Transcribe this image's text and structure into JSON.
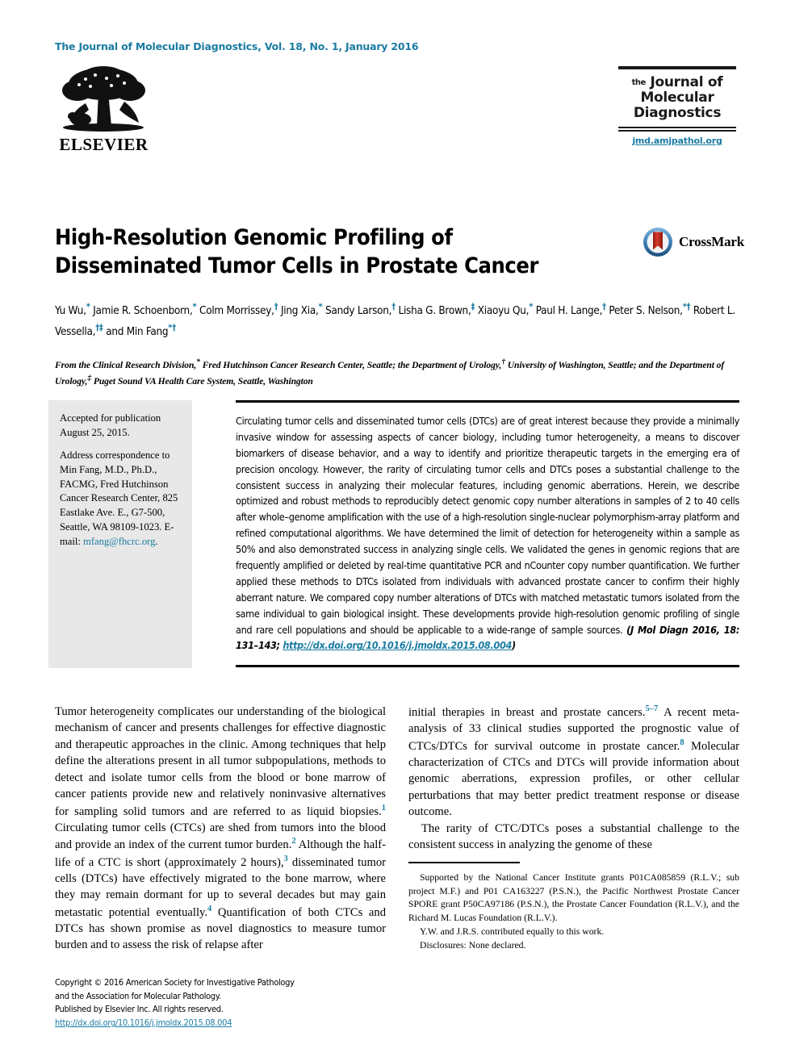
{
  "masthead": {
    "citation_line": "The Journal of Molecular Diagnostics, Vol. 18, No. 1, January 2016",
    "publisher_name": "ELSEVIER",
    "journal_badge": {
      "the": "the",
      "line1": "Journal of",
      "line2": "Molecular",
      "line3": "Diagnostics",
      "url": "jmd.amjpathol.org"
    }
  },
  "article": {
    "title_line1": "High-Resolution Genomic Profiling of",
    "title_line2": "Disseminated Tumor Cells in Prostate Cancer",
    "crossmark_label": "CrossMark",
    "authors": "Yu Wu,* Jamie R. Schoenborn,* Colm Morrissey,† Jing Xia,* Sandy Larson,† Lisha G. Brown,‡ Xiaoyu Qu,* Paul H. Lange,† Peter S. Nelson,*† Robert L. Vessella,†‡ and Min Fang*†",
    "affiliations": "From the Clinical Research Division,* Fred Hutchinson Cancer Research Center, Seattle; the Department of Urology,† University of Washington, Seattle; and the Department of Urology,‡ Puget Sound VA Health Care System, Seattle, Washington"
  },
  "sidenote": {
    "accepted_label": "Accepted for publication",
    "accepted_date": "August 25, 2015.",
    "correspondence": "Address correspondence to Min Fang, M.D., Ph.D., FACMG, Fred Hutchinson Cancer Research Center, 825 Eastlake Ave. E., G7-500, Seattle, WA 98109-1023.  E-mail: ",
    "email": "mfang@fhcrc.org",
    "email_trailing": "."
  },
  "abstract": {
    "text": "Circulating tumor cells and disseminated tumor cells (DTCs) are of great interest because they provide a minimally invasive window for assessing aspects of cancer biology, including tumor heterogeneity, a means to discover biomarkers of disease behavior, and a way to identify and prioritize therapeutic targets in the emerging era of precision oncology. However, the rarity of circulating tumor cells and DTCs poses a substantial challenge to the consistent success in analyzing their molecular features, including genomic aberrations. Herein, we describe optimized and robust methods to reproducibly detect genomic copy number alterations in samples of 2 to 40 cells after whole–genome amplification with the use of a high-resolution single-nuclear polymorphism-array platform and refined computational algorithms. We have determined the limit of detection for heterogeneity within a sample as 50% and also demonstrated success in analyzing single cells. We validated the genes in genomic regions that are frequently amplified or deleted by real-time quantitative PCR and nCounter copy number quantification. We further applied these methods to DTCs isolated from individuals with advanced prostate cancer to confirm their highly aberrant nature. We compared copy number alterations of DTCs with matched metastatic tumors isolated from the same individual to gain biological insight. These developments provide high-resolution genomic profiling of single and rare cell populations and should be applicable to a wide-range of sample sources.",
    "citation_prefix": "(J Mol Diagn  2016, 18: 131",
    "citation_dash": "–",
    "citation_mid": "143; ",
    "citation_doi": "http://dx.doi.org/10.1016/j.jmoldx.2015.08.004",
    "citation_suffix": ")"
  },
  "body": {
    "left_column": [
      "Tumor heterogeneity complicates our understanding of the biological mechanism of cancer and presents challenges for effective diagnostic and therapeutic approaches in the clinic. Among techniques that help define the alterations present in all tumor subpopulations, methods to detect and isolate tumor cells from the blood or bone marrow of cancer patients provide new and relatively noninvasive alternatives for sampling solid tumors and are referred to as liquid biopsies.|1| Circulating tumor cells (CTCs) are shed from tumors into the blood and provide an index of the current tumor burden.|2| Although the half-life of a CTC is short (approximately 2 hours),|3| disseminated tumor cells (DTCs) have effectively migrated to the bone marrow, where they may remain dormant for up to several decades but may gain metastatic potential eventually.|4| Quantification of both CTCs and DTCs has shown promise as novel diagnostics to measure tumor burden and to assess the risk of relapse after"
    ],
    "right_column": [
      "initial therapies in breast and prostate cancers.|5–7| A recent meta-analysis of 33 clinical studies supported the prognostic value of CTCs/DTCs for survival outcome in prostate cancer.|8| Molecular characterization of CTCs and DTCs will provide information about genomic aberrations, expression profiles, or other cellular perturbations that may better predict treatment response or disease outcome.",
      "The rarity of CTC/DTCs poses a substantial challenge to the consistent success in analyzing the genome of these"
    ]
  },
  "footnote": {
    "support": "Supported by the National Cancer Institute grants P01CA085859 (R.L.V.; sub project M.F.) and P01 CA163227 (P.S.N.), the Pacific Northwest Prostate Cancer SPORE grant P50CA97186 (P.S.N.), the Prostate Cancer Foundation (R.L.V.), and the Richard M. Lucas Foundation (R.L.V.).",
    "equal_contribution": "Y.W. and J.R.S. contributed equally to this work.",
    "disclosures": "Disclosures: None declared."
  },
  "copyright": {
    "line1": "Copyright © 2016 American Society for Investigative Pathology",
    "line2": "and the Association for Molecular Pathology.",
    "line3": "Published by Elsevier Inc. All rights reserved.",
    "doi": "http://dx.doi.org/10.1016/j.jmoldx.2015.08.004"
  },
  "colors": {
    "accent_blue": "#1b7ca3",
    "sidenote_bg": "#e8e8e8",
    "rule_black": "#000000",
    "crossmark_blue": "#2b6cb0",
    "crossmark_red": "#b52a1e"
  }
}
